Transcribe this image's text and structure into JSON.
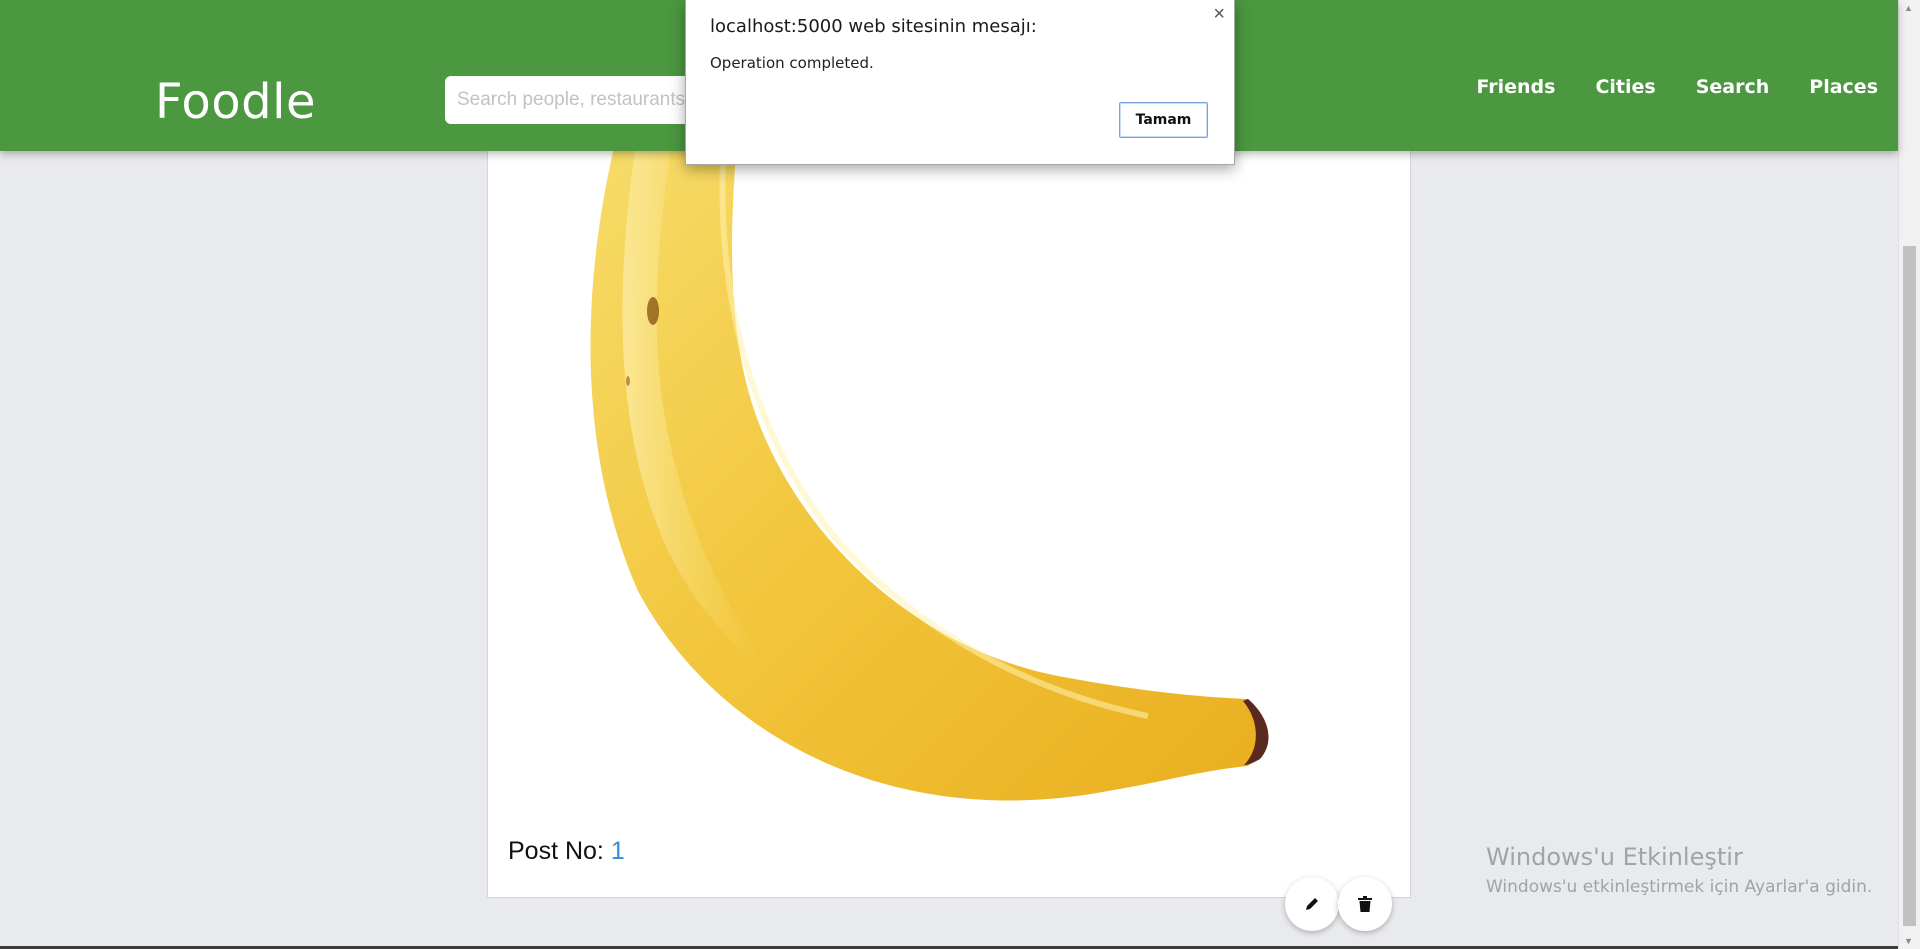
{
  "navbar": {
    "brand": "Foodle",
    "search_placeholder": "Search people, restaurants",
    "links": [
      "Friends",
      "Cities",
      "Search",
      "Places"
    ]
  },
  "post": {
    "no_label": "Post No: ",
    "no_value": "1",
    "image_subject": "banana"
  },
  "dialog": {
    "title": "localhost:5000 web sitesinin mesajı:",
    "message": "Operation completed.",
    "ok_label": "Tamam",
    "close_symbol": "×"
  },
  "watermark": {
    "line1": "Windows'u Etkinleştir",
    "line2": "Windows'u etkinleştirmek için Ayarlar'a gidin."
  },
  "icons": {
    "edit": "pencil-icon",
    "delete": "trash-icon"
  },
  "colors": {
    "navbar": "#4b9840",
    "background": "#e9eaed",
    "link_accent": "#2f8fdc"
  }
}
